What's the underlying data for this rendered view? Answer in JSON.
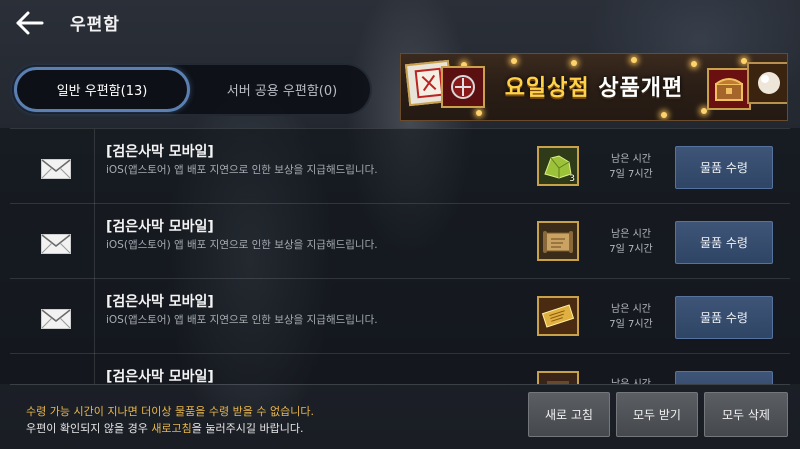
{
  "header": {
    "title": "우편함"
  },
  "tabs": [
    {
      "label": "일반 우편함(13)",
      "active": true
    },
    {
      "label": "서버 공용 우편함(0)",
      "active": false
    }
  ],
  "banner": {
    "text_highlight": "요일상점",
    "text_rest": "상품개편"
  },
  "mails": [
    {
      "title": "[검은사막 모바일]",
      "description": "iOS(앱스토어) 앱 배포 지연으로 인한 보상을 지급해드립니다.",
      "item_icon": "green-ore-icon",
      "item_count": "3",
      "time_label": "남은 시간",
      "time_value": "7일 7시간",
      "claim_label": "물품 수령"
    },
    {
      "title": "[검은사막 모바일]",
      "description": "iOS(앱스토어) 앱 배포 지연으로 인한 보상을 지급해드립니다.",
      "item_icon": "scroll-map-icon",
      "item_count": "",
      "time_label": "남은 시간",
      "time_value": "7일 7시간",
      "claim_label": "물품 수령"
    },
    {
      "title": "[검은사막 모바일]",
      "description": "iOS(앱스토어) 앱 배포 지연으로 인한 보상을 지급해드립니다.",
      "item_icon": "gold-ticket-icon",
      "item_count": "",
      "time_label": "남은 시간",
      "time_value": "7일 7시간",
      "claim_label": "물품 수령"
    },
    {
      "title": "[검은사막 모바일]",
      "description": "",
      "item_icon": "item-icon",
      "item_count": "",
      "time_label": "남은 시간",
      "time_value": "",
      "claim_label": ""
    }
  ],
  "footer": {
    "notice_line1": "수령 가능 시간이 지나면 더이상 물품을 수령 받을 수 없습니다.",
    "notice_line2_pre": "우편이 확인되지 않을 경우 ",
    "notice_line2_highlight": "새로고침",
    "notice_line2_post": "을 눌러주시길 바랍니다.",
    "refresh_label": "새로 고침",
    "receive_all_label": "모두 받기",
    "delete_all_label": "모두 삭제"
  },
  "colors": {
    "accent_gold": "#e8b74a",
    "button_blue": "#3e5578",
    "tab_border": "#5a7fb0"
  }
}
